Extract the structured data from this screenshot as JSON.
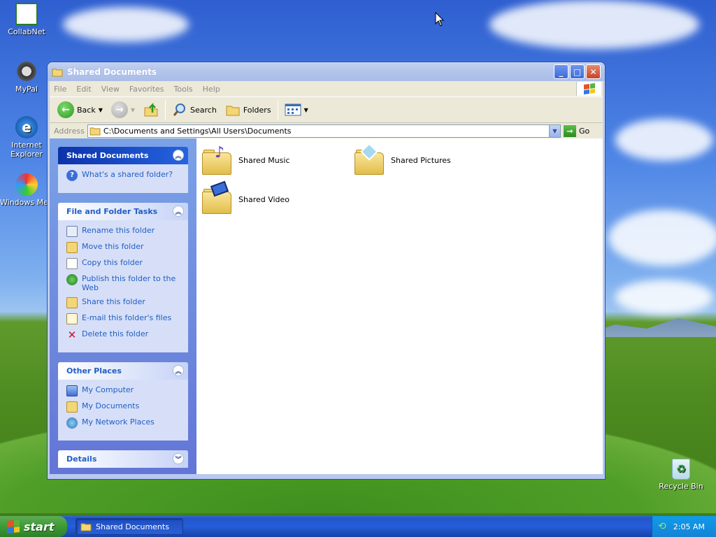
{
  "desktop": {
    "icons": [
      {
        "label": "CollabNet"
      },
      {
        "label": "MyPal"
      },
      {
        "label": "Internet Explorer"
      },
      {
        "label": "Windows Media Player"
      },
      {
        "label": "Recycle Bin"
      }
    ]
  },
  "window": {
    "title": "Shared Documents",
    "menu": [
      "File",
      "Edit",
      "View",
      "Favorites",
      "Tools",
      "Help"
    ],
    "toolbar": {
      "back_label": "Back",
      "search_label": "Search",
      "folders_label": "Folders"
    },
    "address": {
      "label": "Address",
      "value": "C:\\Documents and Settings\\All Users\\Documents",
      "go_label": "Go"
    },
    "taskpane": {
      "special": {
        "title": "Shared Documents",
        "items": [
          "What's a shared folder?"
        ]
      },
      "file_tasks": {
        "title": "File and Folder Tasks",
        "items": [
          "Rename this folder",
          "Move this folder",
          "Copy this folder",
          "Publish this folder to the Web",
          "Share this folder",
          "E-mail this folder's files",
          "Delete this folder"
        ]
      },
      "other_places": {
        "title": "Other Places",
        "items": [
          "My Computer",
          "My Documents",
          "My Network Places"
        ]
      },
      "details": {
        "title": "Details"
      }
    },
    "folders": [
      {
        "name": "Shared Music",
        "overlay": "music-note-icon"
      },
      {
        "name": "Shared Pictures",
        "overlay": "picture-icon"
      },
      {
        "name": "Shared Video",
        "overlay": "film-icon"
      }
    ]
  },
  "taskbar": {
    "start_label": "start",
    "task_label": "Shared Documents",
    "clock": "2:05 AM"
  }
}
